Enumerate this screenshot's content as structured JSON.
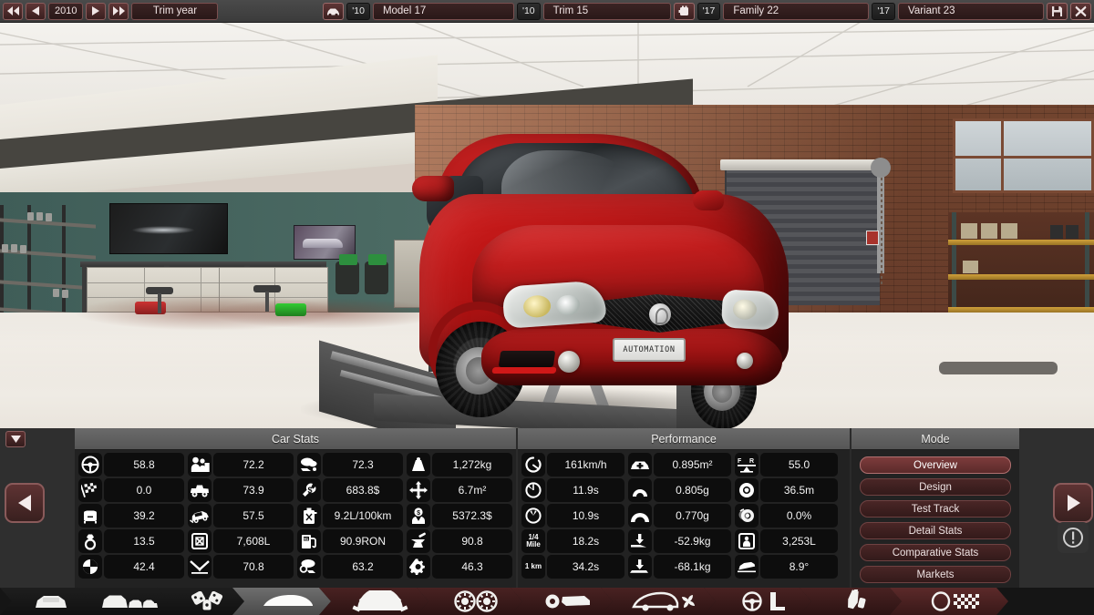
{
  "topbar": {
    "first_label": "◀◀",
    "prev_label": "◀",
    "year": "2010",
    "next_label": "▶",
    "last_label": "▶▶",
    "trim_year_label": "Trim year",
    "model_year": "'10",
    "model_name": "Model 17",
    "trim_year": "'10",
    "trim_name": "Trim 15",
    "family_year": "'17",
    "family_name": "Family 22",
    "variant_year": "'17",
    "variant_name": "Variant 23",
    "save_icon": "floppy-save-icon",
    "close_icon": "close-x-icon",
    "car_icon": "car-icon",
    "engine_icon": "engine-icon"
  },
  "viewport": {
    "license_plate": "AUTOMATION",
    "scene": "garage-showroom-with-red-sedan-on-lift"
  },
  "hud": {
    "collapse_icon": "collapse-down-icon",
    "prev_page_icon": "left-arrow-icon",
    "next_page_icon": "right-arrow-icon",
    "warning_icon": "warning-exclamation-icon"
  },
  "car_stats": {
    "title": "Car Stats",
    "columns": [
      [
        {
          "icon": "steering-wheel-icon",
          "label": "Drivability",
          "value": "58.8"
        },
        {
          "icon": "checkered-flag-icon",
          "label": "Sportiness",
          "value": "0.0"
        },
        {
          "icon": "armchair-icon",
          "label": "Comfort",
          "value": "39.2"
        },
        {
          "icon": "diamond-ring-icon",
          "label": "Prestige",
          "value": "13.5"
        },
        {
          "icon": "pie-chart-icon",
          "label": "Practicality",
          "value": "42.4"
        }
      ],
      [
        {
          "icon": "family-people-icon",
          "label": "Utility",
          "value": "72.2"
        },
        {
          "icon": "pickup-truck-icon",
          "label": "Offroad",
          "value": "73.9"
        },
        {
          "icon": "crash-car-icon",
          "label": "Safety",
          "value": "57.5"
        },
        {
          "icon": "cargo-box-icon",
          "label": "Cargo Volume",
          "value": "7,608L"
        },
        {
          "icon": "reliability-arrow-icon",
          "label": "Reliability",
          "value": "70.8"
        }
      ],
      [
        {
          "icon": "emissions-cloud-icon",
          "label": "Environmental Resistance",
          "value": "72.3"
        },
        {
          "icon": "service-cost-icon",
          "label": "Service Costs",
          "value": "683.8$"
        },
        {
          "icon": "fuel-can-icon",
          "label": "Fuel Economy",
          "value": "9.2L/100km"
        },
        {
          "icon": "fuel-pump-icon",
          "label": "Fuel Octane",
          "value": "90.9RON"
        },
        {
          "icon": "smog-cloud-icon",
          "label": "Emissions",
          "value": "63.2"
        }
      ],
      [
        {
          "icon": "weight-icon",
          "label": "Weight",
          "value": "1,272kg"
        },
        {
          "icon": "footprint-icon",
          "label": "Footprint",
          "value": "6.7m²"
        },
        {
          "icon": "material-cost-icon",
          "label": "Material Cost",
          "value": "5372.3$"
        },
        {
          "icon": "anvil-icon",
          "label": "Engineering Time",
          "value": "90.8"
        },
        {
          "icon": "gears-icon",
          "label": "Production Units",
          "value": "46.3"
        }
      ]
    ]
  },
  "performance": {
    "title": "Performance",
    "columns": [
      [
        {
          "icon": "top-speed-gauge-icon",
          "label": "Top Speed",
          "value": "161km/h"
        },
        {
          "icon": "accel-100-gauge-icon",
          "label": "0-100 km/h",
          "value": "11.9s"
        },
        {
          "icon": "accel-62-gauge-icon",
          "label": "0-62 mph",
          "value": "10.9s"
        },
        {
          "icon": "quarter-mile-icon",
          "label": "1/4 Mile",
          "value": "18.2s"
        },
        {
          "icon": "one-km-icon",
          "label": "1 km",
          "value": "34.2s"
        }
      ],
      [
        {
          "icon": "frontal-area-icon",
          "label": "Drag Area",
          "value": "0.895m²"
        },
        {
          "icon": "corner-20m-icon",
          "label": "20m Skidpad",
          "value": "0.805g"
        },
        {
          "icon": "corner-200m-icon",
          "label": "200m Skidpad",
          "value": "0.770g"
        },
        {
          "icon": "downforce-front-icon",
          "label": "Front Downforce",
          "value": "-52.9kg"
        },
        {
          "icon": "downforce-rear-icon",
          "label": "Rear Downforce",
          "value": "-68.1kg"
        }
      ],
      [
        {
          "icon": "weight-balance-icon",
          "label": "Weight Balance F/R",
          "value": "55.0"
        },
        {
          "icon": "brake-disc-icon",
          "label": "Braking Distance",
          "value": "36.5m"
        },
        {
          "icon": "brake-fade-icon",
          "label": "Brake Fade",
          "value": "0.0%"
        },
        {
          "icon": "passenger-space-icon",
          "label": "Passenger Volume",
          "value": "3,253L"
        },
        {
          "icon": "approach-angle-icon",
          "label": "Approach Angle",
          "value": "8.9°"
        }
      ]
    ]
  },
  "mode": {
    "title": "Mode",
    "buttons": [
      {
        "label": "Overview",
        "active": true
      },
      {
        "label": "Design",
        "active": false
      },
      {
        "label": "Test Track",
        "active": false
      },
      {
        "label": "Detail Stats",
        "active": false
      },
      {
        "label": "Comparative Stats",
        "active": false
      },
      {
        "label": "Markets",
        "active": false
      }
    ]
  },
  "bottom_nav": [
    {
      "icon": "single-car-icon",
      "name": "car-overview-tab",
      "style": "dark"
    },
    {
      "icon": "car-family-icon",
      "name": "family-tab",
      "style": "dark"
    },
    {
      "icon": "dice-gamble-icon",
      "name": "market-tab",
      "style": "dark"
    },
    {
      "icon": "car-body-icon",
      "name": "body-tab",
      "style": "light"
    },
    {
      "icon": "camshaft-icon",
      "name": "engine-tab",
      "style": "red"
    },
    {
      "icon": "wheels-icon",
      "name": "suspension-tab",
      "style": "red"
    },
    {
      "icon": "brake-pad-icon",
      "name": "brakes-tab",
      "style": "red"
    },
    {
      "icon": "aero-fan-icon",
      "name": "aero-cooling-tab",
      "style": "red"
    },
    {
      "icon": "steering-seat-icon",
      "name": "interior-tab",
      "style": "red"
    },
    {
      "icon": "gearbox-icon",
      "name": "drivetrain-tab",
      "style": "red"
    },
    {
      "icon": "test-track-flag-icon",
      "name": "test-track-tab",
      "style": "red2"
    }
  ]
}
